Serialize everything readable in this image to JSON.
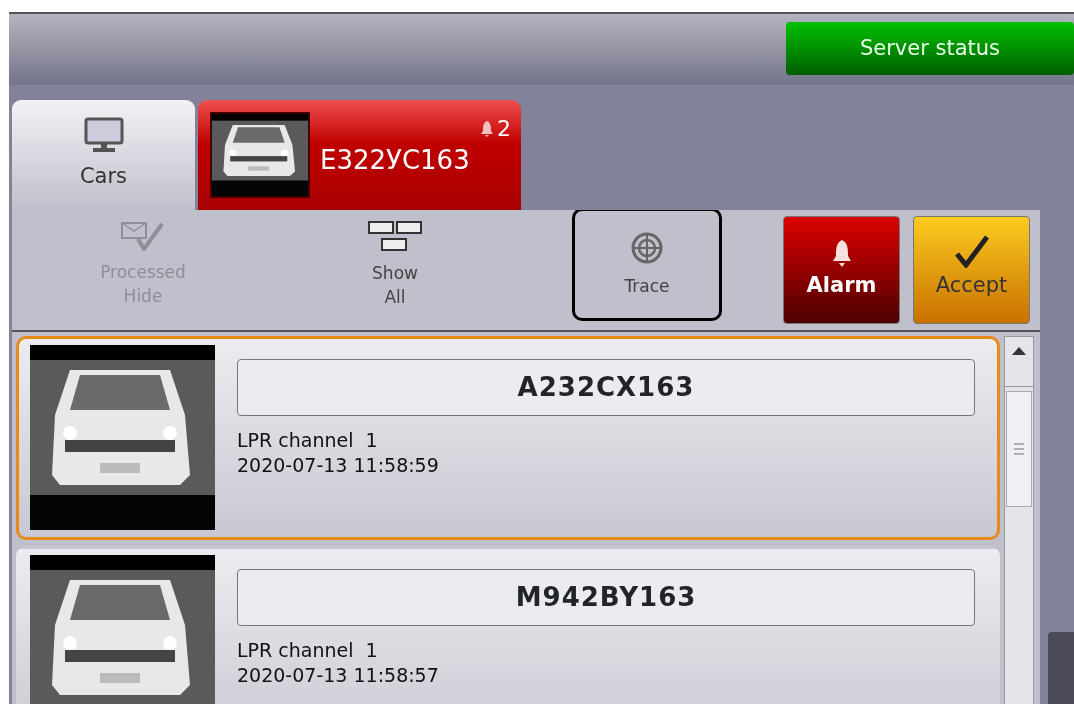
{
  "header": {
    "server_status": "Server status"
  },
  "tabs": [
    {
      "kind": "home",
      "label": "Cars",
      "selected": true
    },
    {
      "kind": "alarm",
      "label": "E322УС163",
      "count": "2",
      "selected": false
    }
  ],
  "toolbar": [
    {
      "kind": "processed",
      "lines": [
        "Processed",
        "Hide"
      ],
      "disabled": true,
      "focused": false
    },
    {
      "kind": "showall",
      "lines": [
        "Show",
        "All"
      ],
      "disabled": false,
      "focused": false
    },
    {
      "kind": "trace",
      "lines": [
        "Trace"
      ],
      "disabled": false,
      "focused": true
    }
  ],
  "actions": [
    {
      "kind": "alarm",
      "label": "Alarm"
    },
    {
      "kind": "accept",
      "label": "Accept"
    }
  ],
  "events": [
    {
      "plate": "A232CX163",
      "channel": "LPR channel  1",
      "time": "2020-07-13 11:58:59",
      "selected": true
    },
    {
      "plate": "M942BY163",
      "channel": "LPR channel  1",
      "time": "2020-07-13 11:58:57",
      "selected": false
    }
  ]
}
